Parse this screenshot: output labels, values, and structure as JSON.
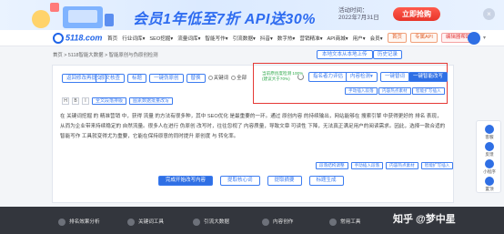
{
  "banner": {
    "title": "会员1年低至7折 API送30%",
    "date_line1": "活动时间：",
    "date_line2": "2022年7月31日",
    "cta": "立即抢购",
    "close": "×"
  },
  "nav": {
    "logo": "5118.com",
    "items": [
      "首页",
      "行业词库▾",
      "SEO挖掘▾",
      "流量词库▾",
      "智能写作▾",
      "引流数据▾",
      "抖音▾",
      "数字热▾",
      "营销精准▾",
      "API商城▾",
      "用户▾",
      "会员▾"
    ],
    "right": [
      "首页",
      "专属API",
      "编辑器帮助▾"
    ]
  },
  "crumb": {
    "text": "首页 > 5118智能大数据 > 智能原创与伪原创检测",
    "upload_label": "本地文本从本地上传",
    "history_label": "历史记录"
  },
  "toolbar": {
    "rewrite_label": "返回修改再提交",
    "options": [
      "原文核查",
      "标题",
      "一键伪原创",
      "替换"
    ],
    "radios": [
      "关键词",
      "全部"
    ]
  },
  "format_row": {
    "items": [
      "H",
      "B",
      "I"
    ],
    "tags": [
      "全文段落排版",
      "图素数据批量改写"
    ]
  },
  "redbox": {
    "stat_line1": "当前原创度检测 100%",
    "stat_line2": "(建议大于70%)",
    "btn_originality": "指名者力评估",
    "btn_content_check": "内容检测▾",
    "btn_one_click": "一键替词",
    "btn_rewrite": "一键智能改写",
    "sub_btn_1": "手动插入段落",
    "sub_btn_2": "内容热点素材",
    "sub_btn_3": "智能扩写插入"
  },
  "article": {
    "text": "在 关键词挖掘 的 精准营销 中，获得 流量 的方法有很多种，其中 SEO优化 是最重要的一环。通过 原创内容 的持续输出，网站能够在 搜索引擎 中获得更好的 排名 表现，从而为企业带来持续稳定的 自然流量。很多人在进行 伪原创 改写时，往往忽视了 内容质量，导致文章 可读性 下降，无法真正满足用户的阅读需求。因此，选择一款合适的 智能写作 工具就变得尤为重要，它能在保持原意的同时提升 原创度 与 转化率。"
  },
  "tags": [
    "段落结构调整",
    "手动插入段落",
    "内容热点素材",
    "智能扩写插入"
  ],
  "bottom_actions": [
    "完成开始改写内容",
    "提取核心词",
    "提取摘要",
    "标题生成"
  ],
  "float_bar": [
    "客服",
    "反馈",
    "小程序",
    "置顶"
  ],
  "footer": {
    "items": [
      "排名效果分析",
      "关键词工具",
      "引流大数据",
      "内容创作",
      "常用工具"
    ],
    "watermark": "知乎 @梦中星"
  },
  "colors": {
    "accent": "#2f6fe4",
    "highlight_box": "#e53935",
    "banner_title": "#2d6bf0",
    "cta_red": "#e8352a"
  }
}
